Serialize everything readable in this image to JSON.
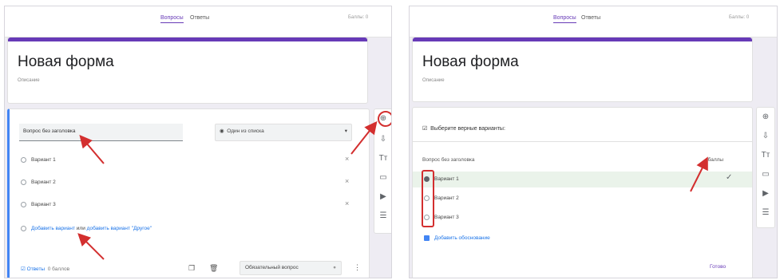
{
  "left": {
    "tabs": [
      "Вопросы",
      "Ответы"
    ],
    "top_right": "Баллы: 0",
    "form_title": "Новая форма",
    "form_description": "Описание",
    "question_placeholder": "Вопрос без заголовка",
    "type_select": "Один из списка",
    "options": [
      "Вариант 1",
      "Вариант 2",
      "Вариант 3"
    ],
    "add_option_link": "Добавить вариант",
    "add_option_or": "или",
    "add_other_link": "добавить вариант \"Другое\"",
    "footer_answers": "Ответы",
    "footer_points": "0 баллов",
    "required_label": "Обязательный вопрос"
  },
  "right": {
    "tabs": [
      "Вопросы",
      "Ответы"
    ],
    "top_right": "Баллы: 0",
    "form_title": "Новая форма",
    "form_description": "Описание",
    "choose_correct": "Выберите верные варианты:",
    "question_label": "Вопрос без заголовка",
    "points_label": "баллы",
    "options": [
      "Вариант 1",
      "Вариант 2",
      "Вариант 3"
    ],
    "feedback_link": "Добавить обоснование",
    "done_button": "Готово"
  },
  "colors": {
    "accent": "#673ab7",
    "highlight": "#d32f2f",
    "link": "#1a73e8"
  },
  "icons": [
    "add-question-icon",
    "import-icon",
    "title-icon",
    "image-icon",
    "video-icon",
    "section-icon"
  ]
}
